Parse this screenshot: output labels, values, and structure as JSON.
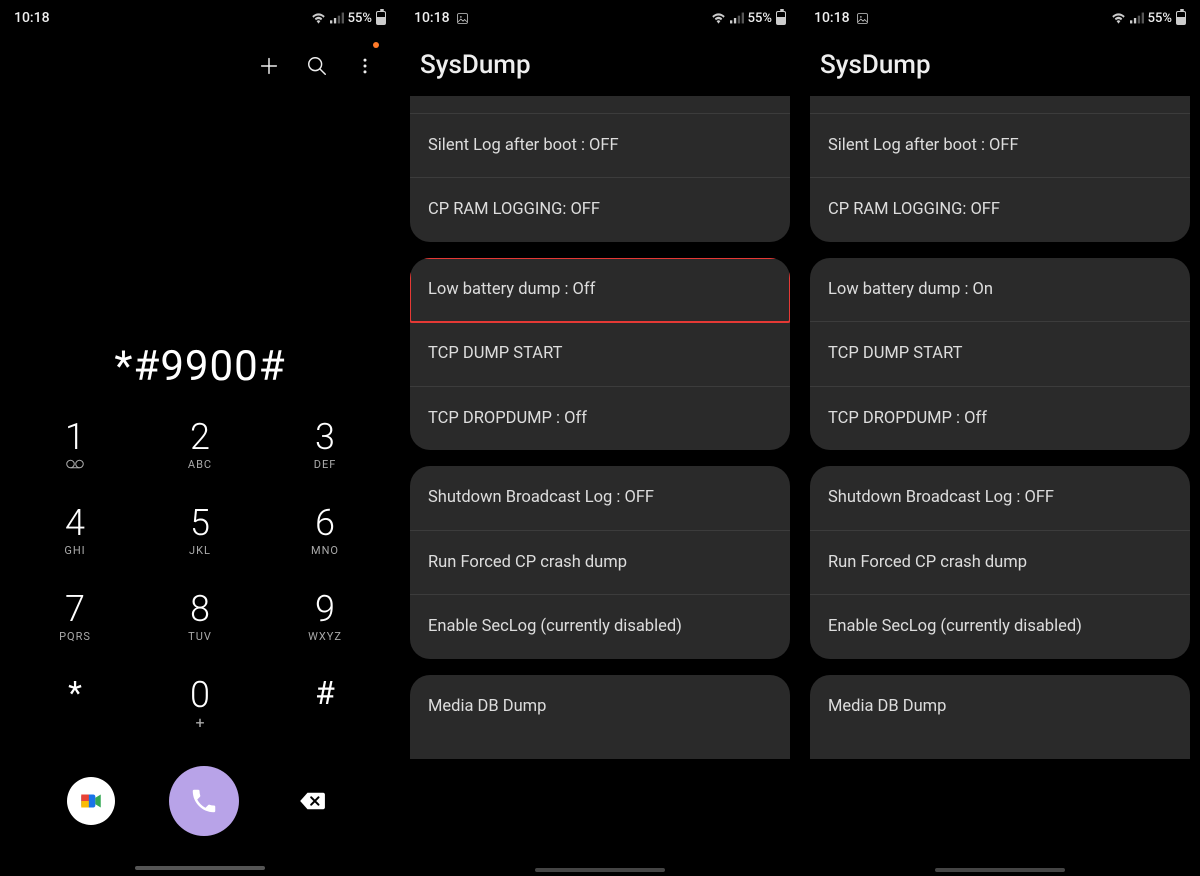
{
  "status": {
    "time": "10:18",
    "battery": "55%"
  },
  "dialer": {
    "number": "*#9900#",
    "keys": [
      {
        "digit": "1",
        "sub": "vm"
      },
      {
        "digit": "2",
        "sub": "ABC"
      },
      {
        "digit": "3",
        "sub": "DEF"
      },
      {
        "digit": "4",
        "sub": "GHI"
      },
      {
        "digit": "5",
        "sub": "JKL"
      },
      {
        "digit": "6",
        "sub": "MNO"
      },
      {
        "digit": "7",
        "sub": "PQRS"
      },
      {
        "digit": "8",
        "sub": "TUV"
      },
      {
        "digit": "9",
        "sub": "WXYZ"
      },
      {
        "digit": "*",
        "sub": ""
      },
      {
        "digit": "0",
        "sub": "+"
      },
      {
        "digit": "#",
        "sub": ""
      }
    ]
  },
  "sysdump": {
    "title": "SysDump",
    "panel2": {
      "group1": [
        "Silent Log after boot : OFF",
        "CP RAM LOGGING: OFF"
      ],
      "group2": [
        "Low battery dump : Off",
        "TCP DUMP START",
        "TCP DROPDUMP : Off"
      ],
      "group3": [
        "Shutdown Broadcast Log : OFF",
        "Run Forced CP crash dump",
        "Enable SecLog (currently disabled)"
      ],
      "group4": [
        "Media DB Dump"
      ],
      "highlight_item": "Low battery dump : Off"
    },
    "panel3": {
      "group1": [
        "Silent Log after boot : OFF",
        "CP RAM LOGGING: OFF"
      ],
      "group2": [
        "Low battery dump : On",
        "TCP DUMP START",
        "TCP DROPDUMP : Off"
      ],
      "group3": [
        "Shutdown Broadcast Log : OFF",
        "Run Forced CP crash dump",
        "Enable SecLog (currently disabled)"
      ],
      "group4": [
        "Media DB Dump"
      ]
    }
  }
}
